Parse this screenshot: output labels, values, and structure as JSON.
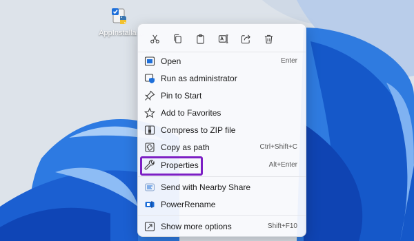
{
  "desktop_icon": {
    "label": "AppInstalla..."
  },
  "toolbar": {
    "buttons": [
      {
        "icon": "cut-icon"
      },
      {
        "icon": "copy-icon"
      },
      {
        "icon": "paste-icon"
      },
      {
        "icon": "rename-icon"
      },
      {
        "icon": "share-icon"
      },
      {
        "icon": "delete-icon"
      }
    ]
  },
  "menu": {
    "open": {
      "label": "Open",
      "shortcut": "Enter"
    },
    "run_as_admin": {
      "label": "Run as administrator"
    },
    "pin_to_start": {
      "label": "Pin to Start"
    },
    "add_to_favorites": {
      "label": "Add to Favorites"
    },
    "compress_zip": {
      "label": "Compress to ZIP file"
    },
    "copy_as_path": {
      "label": "Copy as path",
      "shortcut": "Ctrl+Shift+C"
    },
    "properties": {
      "label": "Properties",
      "shortcut": "Alt+Enter"
    },
    "nearby_share": {
      "label": "Send with Nearby Share"
    },
    "powerrename": {
      "label": "PowerRename"
    },
    "more_options": {
      "label": "Show more options",
      "shortcut": "Shift+F10"
    }
  },
  "colors": {
    "highlight": "#7c1fc4",
    "accent": "#1e6fd9"
  }
}
